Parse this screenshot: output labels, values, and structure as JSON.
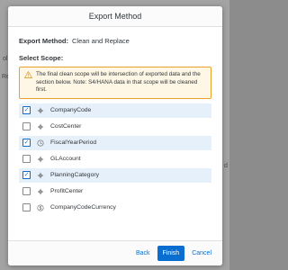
{
  "dialog": {
    "title": "Export Method"
  },
  "export_method": {
    "label": "Export Method:",
    "value": "Clean and Replace"
  },
  "scope": {
    "label": "Select Scope:",
    "warning": "The final clean scope will be intersection of exported data and the section below. Note: S4/HANA data in that scope will be cleaned first.",
    "items": [
      {
        "label": "CompanyCode",
        "checked": true,
        "icon": "dimension-icon"
      },
      {
        "label": "CostCenter",
        "checked": false,
        "icon": "dimension-icon"
      },
      {
        "label": "FiscalYearPeriod",
        "checked": true,
        "icon": "clock-icon"
      },
      {
        "label": "GLAccount",
        "checked": false,
        "icon": "dimension-icon"
      },
      {
        "label": "PlanningCategory",
        "checked": true,
        "icon": "dimension-icon"
      },
      {
        "label": "ProfitCenter",
        "checked": false,
        "icon": "dimension-icon"
      },
      {
        "label": "CompanyCodeCurrency",
        "checked": false,
        "icon": "currency-icon"
      }
    ]
  },
  "footer": {
    "back": "Back",
    "finish": "Finish",
    "cancel": "Cancel"
  },
  "background": {
    "frag1": "ol",
    "frag2": "Re",
    "frag3": "d"
  },
  "colors": {
    "accent": "#0a6ed1",
    "warning_border": "#e9a12a",
    "warning_bg": "#fef7e5",
    "selected_row": "#e5f0fa"
  }
}
